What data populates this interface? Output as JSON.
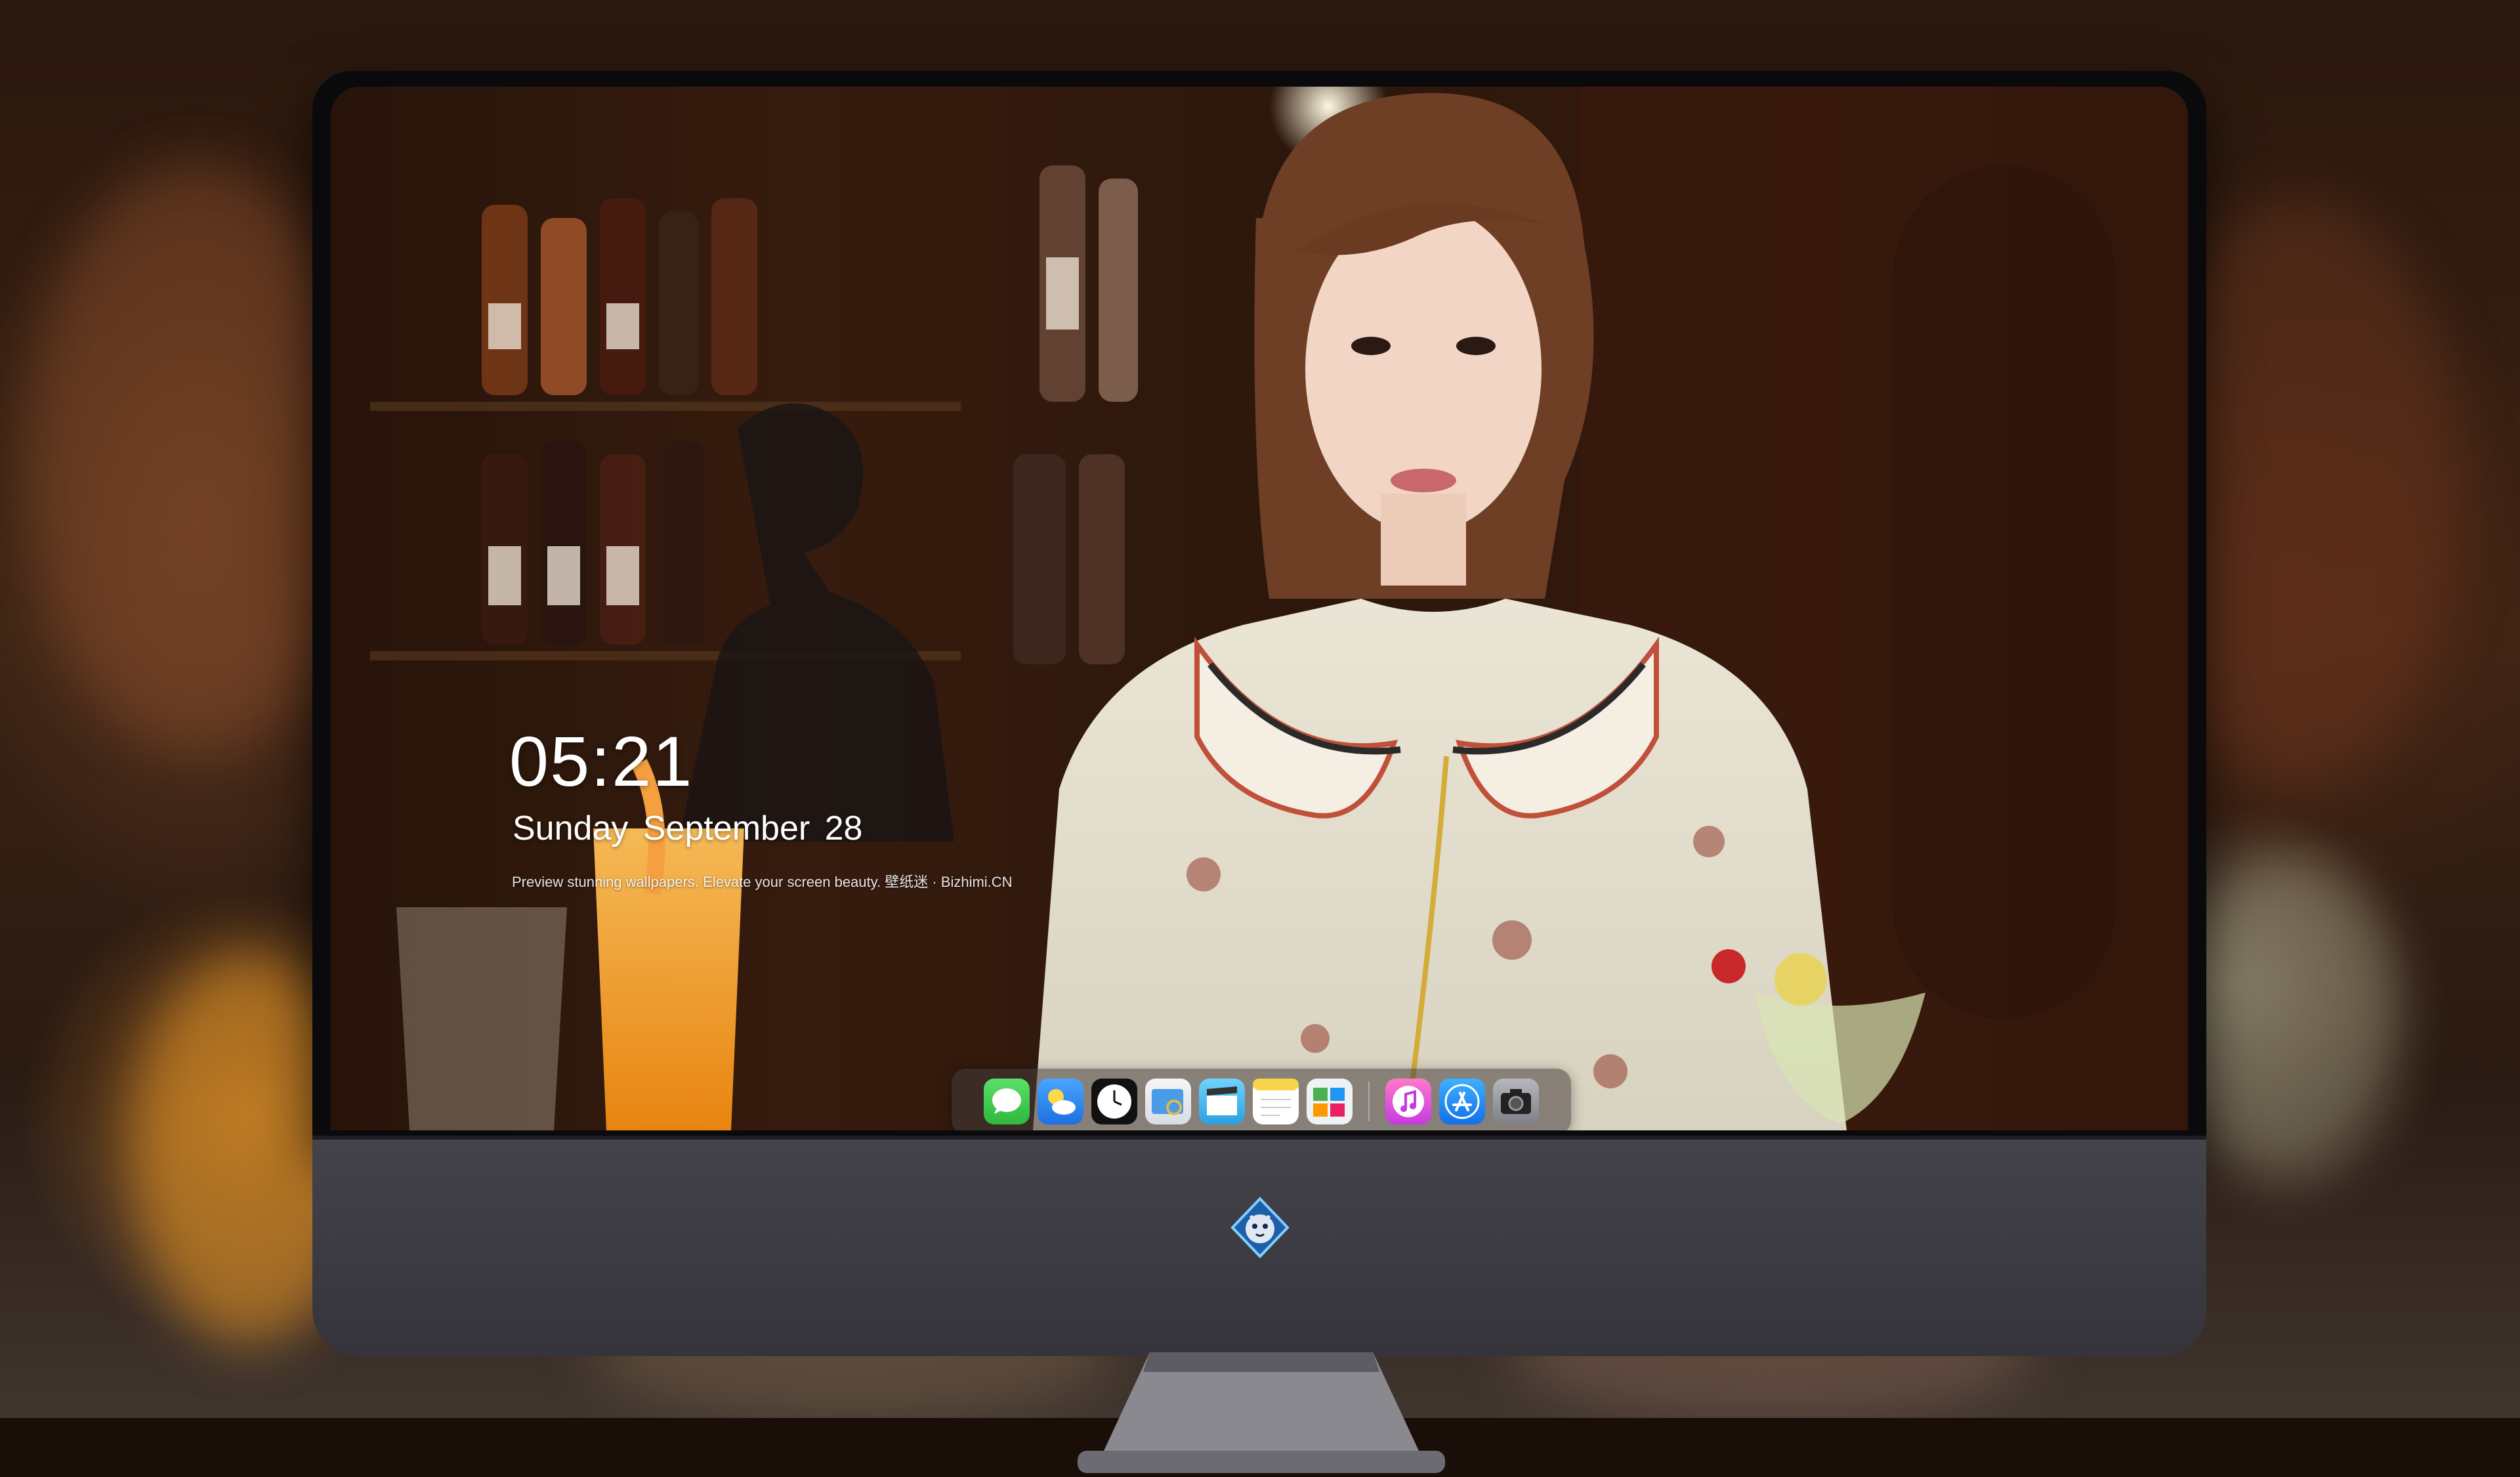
{
  "lock_screen": {
    "time": "05:21",
    "date": "Sunday September  28",
    "tagline": "Preview stunning wallpapers. Elevate your screen beauty. 壁纸迷 · Bizhimi.CN"
  },
  "dock": {
    "apps": [
      {
        "name": "messages-icon",
        "color": "#3ccd4a"
      },
      {
        "name": "weather-icon",
        "color": "#2f8cf0"
      },
      {
        "name": "clock-icon",
        "color": "#ffffff"
      },
      {
        "name": "preview-icon",
        "color": "#4a9be8"
      },
      {
        "name": "clips-icon",
        "color": "#5ec6f0"
      },
      {
        "name": "notes-icon",
        "color": "#f7d54a"
      },
      {
        "name": "photos-gallery-icon",
        "color": "#e9eef2"
      },
      {
        "name": "music-icon",
        "color": "#e94aa6"
      },
      {
        "name": "app-store-icon",
        "color": "#1e8ef5"
      },
      {
        "name": "camera-icon",
        "color": "#9a9ca2"
      }
    ]
  },
  "monitor": {
    "bezel_color": "#0a0a0c",
    "chin_color": "#3d3b42",
    "logo": "dragon-badge-logo"
  }
}
